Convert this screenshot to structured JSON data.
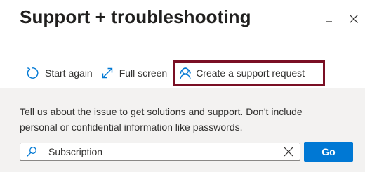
{
  "pane": {
    "title": "Support + troubleshooting",
    "minimize_icon": "minimize-icon",
    "close_icon": "close-icon"
  },
  "toolbar": {
    "start_again_label": "Start again",
    "start_again_icon": "refresh-icon",
    "full_screen_label": "Full screen",
    "full_screen_icon": "expand-icon",
    "support_request_label": "Create a support request",
    "support_request_icon": "support-person-icon",
    "highlight_color": "#7a0f24"
  },
  "main": {
    "description": "Tell us about the issue to get solutions and support. Don't include personal or confidential information like passwords.",
    "search": {
      "value": "Subscription",
      "placeholder": "",
      "icon": "search-icon",
      "clear_icon": "clear-icon"
    },
    "go_label": "Go",
    "accent_color": "#0078d4"
  }
}
